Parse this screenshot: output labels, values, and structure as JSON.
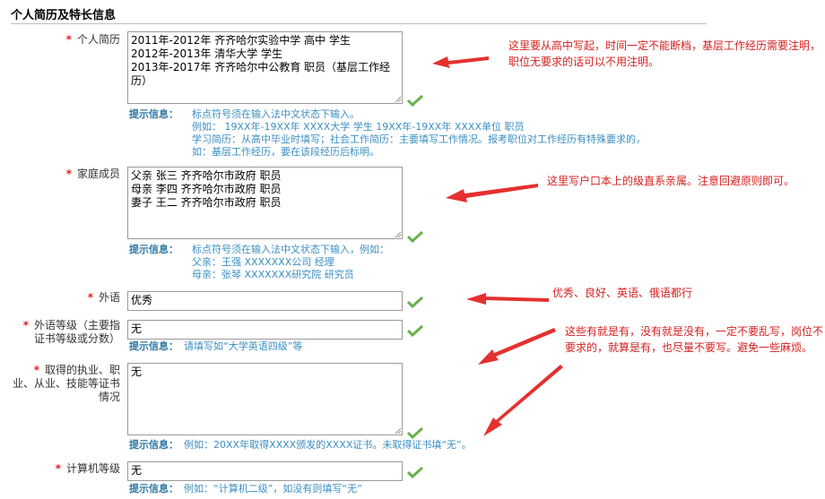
{
  "section_title": "个人简历及特长信息",
  "fields": {
    "resume": {
      "label": "个人简历",
      "value": "2011年-2012年 齐齐哈尔实验中学 高中 学生\n2012年-2013年 清华大学 学生\n2013年-2017年 齐齐哈尔中公教育 职员（基层工作经历）",
      "hint_title": "提示信息：",
      "hint_lines": [
        "标点符号须在输入法中文状态下输入。",
        "例如： 19XX年-19XX年 XXXX大学 学生 19XX年-19XX年 XXXX单位 职员",
        "学习简历：从高中毕业时填写；社会工作简历：主要填写工作情况。报考职位对工作经历有特殊要求的，",
        "如：基层工作经历，要在该段经历后标明。"
      ]
    },
    "family": {
      "label": "家庭成员",
      "value": "父亲 张三 齐齐哈尔市政府 职员\n母亲 李四 齐齐哈尔市政府 职员\n妻子 王二 齐齐哈尔市政府 职员",
      "hint_title": "提示信息：",
      "hint_lines": [
        "标点符号须在输入法中文状态下输入，例如：",
        "父亲：王强 XXXXXXX公司  经理",
        "母亲：张琴 XXXXXXX研究院  研究员"
      ]
    },
    "language": {
      "label": "外语",
      "value": "优秀"
    },
    "language_level": {
      "label_lines": [
        "外语等级（主要指",
        "证书等级或分数）"
      ],
      "value": "无",
      "hint_title": "提示信息：",
      "hint_text": "请填写如“大学英语四级”等"
    },
    "certificates": {
      "label_lines": [
        "取得的执业、职",
        "业、从业、技能等证书",
        "情况"
      ],
      "value": "无",
      "hint_title": "提示信息：",
      "hint_text": "例如：20XX年取得XXXX颁发的XXXX证书。未取得证书填“无”。"
    },
    "computer_level": {
      "label": "计算机等级",
      "value": "无",
      "hint_title": "提示信息：",
      "hint_text": "例如：“计算机二级”，如没有则填写“无”"
    }
  },
  "annotations": {
    "resume_note": "这里要从高中写起，时间一定不能断档，基层工作经历需要注明，职位无要求的话可以不用注明。",
    "family_note": "这里写户口本上的级直系亲属。注意回避原则即可。",
    "language_note": "优秀、良好、英语、俄语都行",
    "certificate_note": "这些有就是有，没有就是没有，一定不要乱写，岗位不要求的，就算是有，也尽量不要写。避免一些麻烦。"
  },
  "colors": {
    "annotation": "#d42020",
    "hint": "#3b8fc2",
    "required_star": "#dd2222",
    "check": "#6ab04c"
  },
  "icons": {
    "required": "asterisk-icon",
    "valid": "green-check-icon",
    "resize": "resize-grip-icon"
  }
}
